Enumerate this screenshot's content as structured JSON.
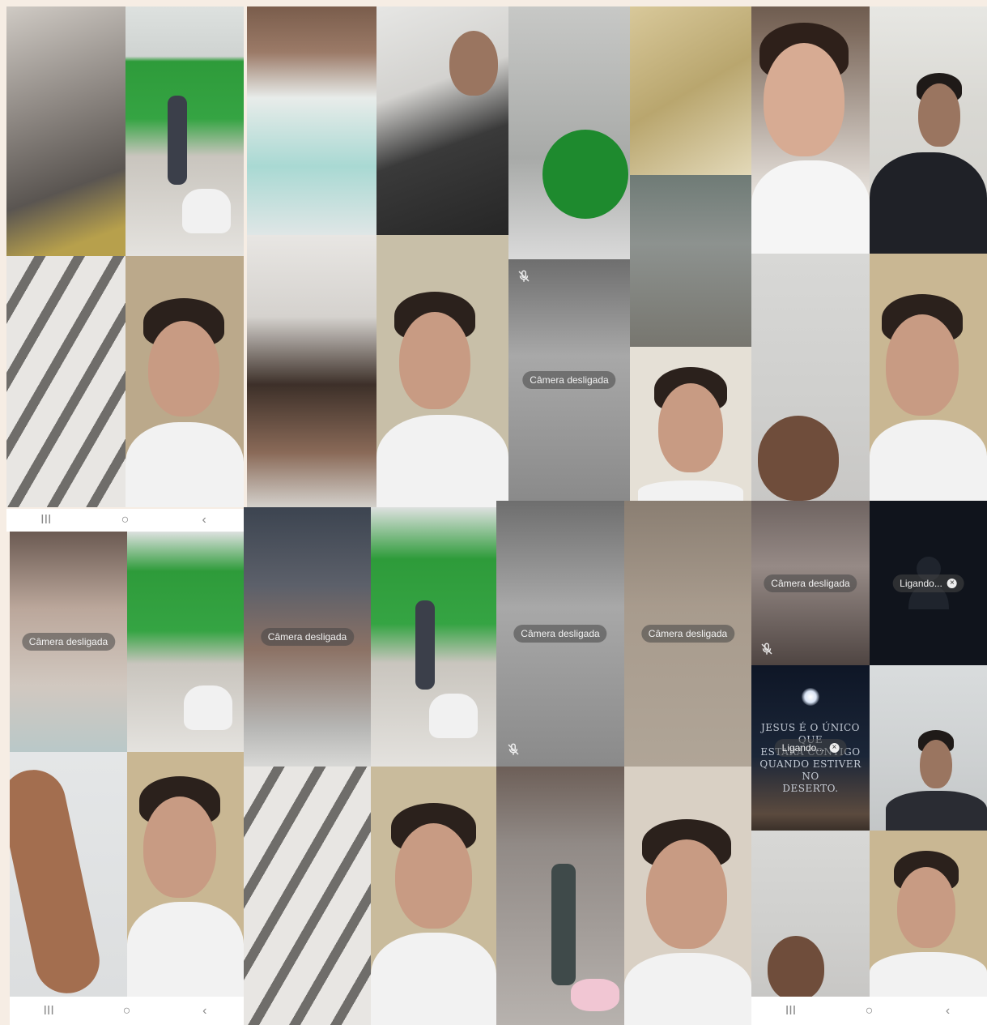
{
  "labels": {
    "camera_off": "Câmera desligada",
    "calling": "Ligando...",
    "quote_line1": "JESUS É O ÚNICO QUE",
    "quote_line2": "ESTARÁ CONTIGO",
    "quote_line3": "QUANDO ESTIVER NO",
    "quote_line4": "DESERTO."
  },
  "nav": {
    "recent_icon": "III",
    "home_icon": "○",
    "back_icon": "‹"
  },
  "colors": {
    "page_background": "#f6ede4",
    "green_wall": "#2e9b3a",
    "dark_tile": "#10141c",
    "navbar": "#ffffff"
  },
  "icons": [
    "mic-off-icon",
    "close-icon",
    "person-placeholder-icon",
    "recent-apps-icon",
    "home-icon",
    "back-icon"
  ]
}
